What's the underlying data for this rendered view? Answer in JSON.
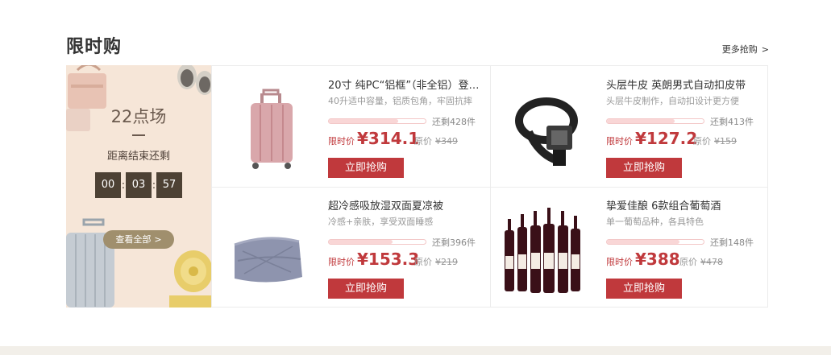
{
  "header": {
    "title": "限时购",
    "more_label": "更多抢购",
    "more_arrow": ">"
  },
  "session": {
    "title": "22点场",
    "remaining_label": "距离结束还剩",
    "timer": [
      "00",
      "03",
      "57"
    ],
    "timer_sep": ":",
    "view_all_label": "查看全部",
    "view_all_arrow": ">"
  },
  "products": [
    {
      "name": "20寸 纯PC“铝框”（非全铝）登…",
      "desc": "40升适中容量，铝质包角，牢固抗摔",
      "stock_text": "还剩428件",
      "stock_fraction": 0.72,
      "price_label": "限时价",
      "price": "¥314.1",
      "orig_label": "原价",
      "orig_price": "¥349",
      "buy_label": "立即抢购",
      "icon": "suitcase-icon"
    },
    {
      "name": "头层牛皮 英朗男式自动扣皮带",
      "desc": "头层牛皮制作，自动扣设计更方便",
      "stock_text": "还剩413件",
      "stock_fraction": 0.7,
      "price_label": "限时价",
      "price": "¥127.2",
      "orig_label": "原价",
      "orig_price": "¥159",
      "buy_label": "立即抢购",
      "icon": "belt-icon"
    },
    {
      "name": "超冷感吸放湿双面夏凉被",
      "desc": "冷感+亲肤，享受双面睡感",
      "stock_text": "还剩396件",
      "stock_fraction": 0.66,
      "price_label": "限时价",
      "price": "¥153.3",
      "orig_label": "原价",
      "orig_price": "¥219",
      "buy_label": "立即抢购",
      "icon": "blanket-icon"
    },
    {
      "name": "挚爱佳酿 6款组合葡萄酒",
      "desc": "单一葡萄品种，各具特色",
      "stock_text": "还剩148件",
      "stock_fraction": 0.75,
      "price_label": "限时价",
      "price": "¥388",
      "orig_label": "原价",
      "orig_price": "¥478",
      "buy_label": "立即抢购",
      "icon": "wine-bottles-icon"
    }
  ],
  "colors": {
    "accent": "#c0393c",
    "panel_bg": "#f6e6d8",
    "timer_box": "#4d4134",
    "view_all_btn": "#a08f6d"
  }
}
